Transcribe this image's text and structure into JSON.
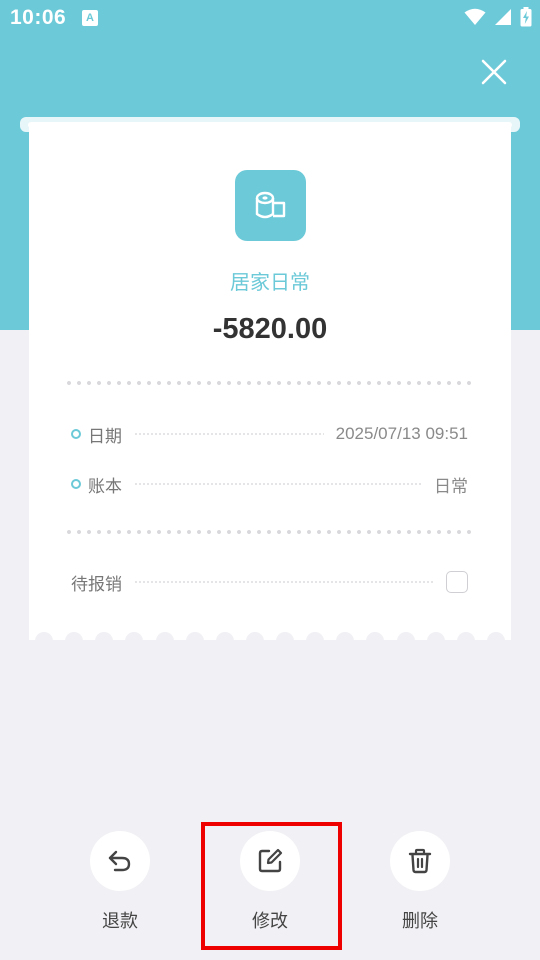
{
  "status_bar": {
    "time": "10:06",
    "notification_icon": "A",
    "icons": [
      "a-badge-icon",
      "wifi-icon",
      "signal-icon",
      "battery-charging-icon"
    ]
  },
  "header": {
    "close_icon": "close-icon"
  },
  "receipt": {
    "category_icon": "toilet-paper-icon",
    "category_name": "居家日常",
    "amount": "-5820.00",
    "rows": [
      {
        "label": "日期",
        "value": "2025/07/13 09:51"
      },
      {
        "label": "账本",
        "value": "日常"
      }
    ],
    "reimbursement": {
      "label": "待报销",
      "checked": false
    }
  },
  "actions": [
    {
      "label": "退款",
      "icon": "undo-icon"
    },
    {
      "label": "修改",
      "icon": "edit-icon"
    },
    {
      "label": "删除",
      "icon": "trash-icon"
    }
  ],
  "colors": {
    "accent": "#6bc9d8",
    "background": "#f1f1f5",
    "amount_text": "#333333",
    "highlight": "#ee0000"
  }
}
